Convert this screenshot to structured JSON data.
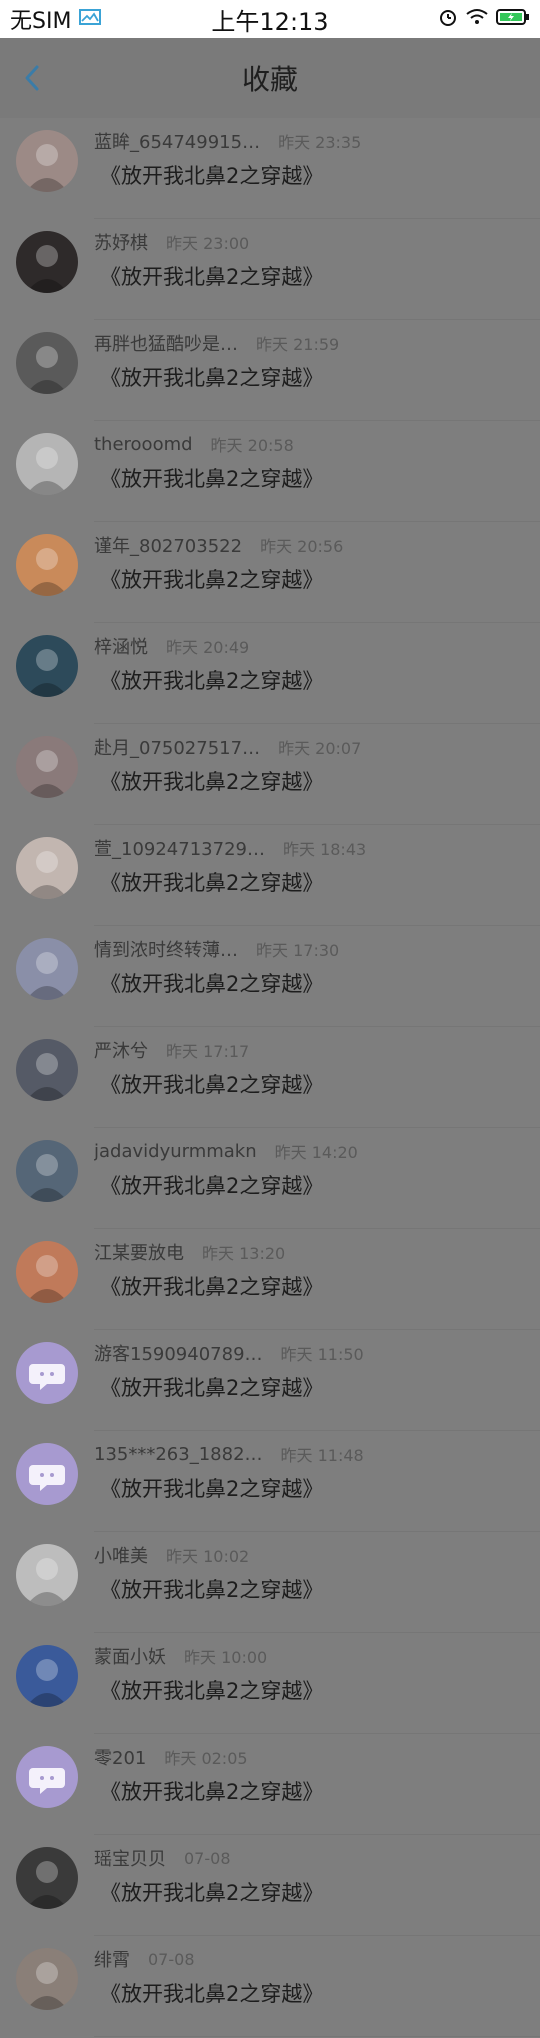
{
  "status": {
    "carrier": "无SIM",
    "time": "上午12:13",
    "icons": [
      "image-icon",
      "alarm-icon",
      "wifi-icon",
      "battery-icon"
    ],
    "battery_color": "#34c759"
  },
  "header": {
    "title": "收藏",
    "back_icon": "chevron-left-icon",
    "accent": "#3a7ca8"
  },
  "list": [
    {
      "name": "蓝眸_654749915…",
      "time": "昨天 23:35",
      "book": "《放开我北鼻2之穿越》",
      "avatar": "photo"
    },
    {
      "name": "苏妤棋",
      "time": "昨天 23:00",
      "book": "《放开我北鼻2之穿越》",
      "avatar": "photo"
    },
    {
      "name": "再胖也猛酷吵是…",
      "time": "昨天 21:59",
      "book": "《放开我北鼻2之穿越》",
      "avatar": "photo"
    },
    {
      "name": "therooomd",
      "time": "昨天 20:58",
      "book": "《放开我北鼻2之穿越》",
      "avatar": "photo"
    },
    {
      "name": "谨年_802703522",
      "time": "昨天 20:56",
      "book": "《放开我北鼻2之穿越》",
      "avatar": "photo"
    },
    {
      "name": "梓涵悦",
      "time": "昨天 20:49",
      "book": "《放开我北鼻2之穿越》",
      "avatar": "photo"
    },
    {
      "name": "赴月_075027517…",
      "time": "昨天 20:07",
      "book": "《放开我北鼻2之穿越》",
      "avatar": "photo"
    },
    {
      "name": "萱_10924713729…",
      "time": "昨天 18:43",
      "book": "《放开我北鼻2之穿越》",
      "avatar": "photo"
    },
    {
      "name": "情到浓时终转薄…",
      "time": "昨天 17:30",
      "book": "《放开我北鼻2之穿越》",
      "avatar": "photo"
    },
    {
      "name": "严沐兮",
      "time": "昨天 17:17",
      "book": "《放开我北鼻2之穿越》",
      "avatar": "photo"
    },
    {
      "name": "jadavidyurmmakn",
      "time": "昨天 14:20",
      "book": "《放开我北鼻2之穿越》",
      "avatar": "photo"
    },
    {
      "name": "江某要放电",
      "time": "昨天 13:20",
      "book": "《放开我北鼻2之穿越》",
      "avatar": "photo"
    },
    {
      "name": "游客1590940789…",
      "time": "昨天 11:50",
      "book": "《放开我北鼻2之穿越》",
      "avatar": "default"
    },
    {
      "name": "135***263_1882…",
      "time": "昨天 11:48",
      "book": "《放开我北鼻2之穿越》",
      "avatar": "default"
    },
    {
      "name": "小唯美",
      "time": "昨天 10:02",
      "book": "《放开我北鼻2之穿越》",
      "avatar": "photo"
    },
    {
      "name": "蒙面小妖",
      "time": "昨天 10:00",
      "book": "《放开我北鼻2之穿越》",
      "avatar": "photo"
    },
    {
      "name": "零201",
      "time": "昨天 02:05",
      "book": "《放开我北鼻2之穿越》",
      "avatar": "default"
    },
    {
      "name": "瑶宝贝贝",
      "time": "07-08",
      "book": "《放开我北鼻2之穿越》",
      "avatar": "photo"
    },
    {
      "name": "绯霄",
      "time": "07-08",
      "book": "《放开我北鼻2之穿越》",
      "avatar": "photo"
    }
  ]
}
